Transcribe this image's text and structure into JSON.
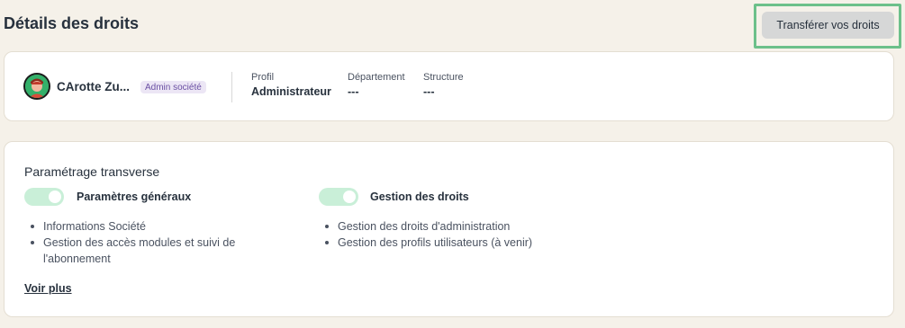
{
  "header": {
    "title": "Détails des droits",
    "transfer_label": "Transférer vos droits"
  },
  "profile": {
    "name": "CArotte Zu...",
    "role_badge": "Admin société",
    "fields": [
      {
        "label": "Profil",
        "value": "Administrateur"
      },
      {
        "label": "Département",
        "value": "---"
      },
      {
        "label": "Structure",
        "value": "---"
      }
    ]
  },
  "settings": {
    "section_title": "Paramétrage transverse",
    "groups": [
      {
        "label": "Paramètres généraux",
        "enabled": true,
        "items": [
          "Informations Société",
          "Gestion des accès modules et suivi de l'abonnement"
        ]
      },
      {
        "label": "Gestion des droits",
        "enabled": true,
        "items": [
          "Gestion des droits d'administration",
          "Gestion des profils utilisateurs (à venir)"
        ]
      }
    ],
    "see_more": "Voir plus"
  },
  "colors": {
    "background": "#f5f1e9",
    "toggle_on": "#c9efd8",
    "highlight": "#6cc08a",
    "badge_bg": "#ece6f5",
    "badge_text": "#6a4fa3"
  }
}
